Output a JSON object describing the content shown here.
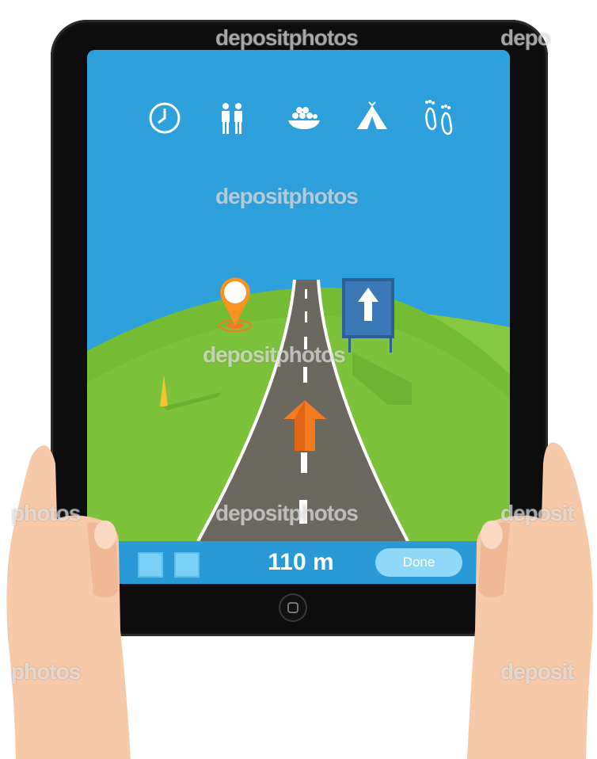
{
  "watermark": "depositphotos",
  "watermark_fragments": [
    "depo",
    "photos",
    "deposit"
  ],
  "navigation": {
    "distance": "110 m",
    "done_label": "Done"
  },
  "icons": [
    "clock-icon",
    "people-icon",
    "food-bowl-icon",
    "tent-icon",
    "footprints-icon"
  ],
  "colors": {
    "sky": "#2ea1dc",
    "grass": "#7cc23a",
    "road": "#6b6860",
    "arrow": "#f47a1f",
    "sign": "#3a78b8",
    "bar": "#2a9ad6",
    "done_button": "#8fd8f8"
  }
}
